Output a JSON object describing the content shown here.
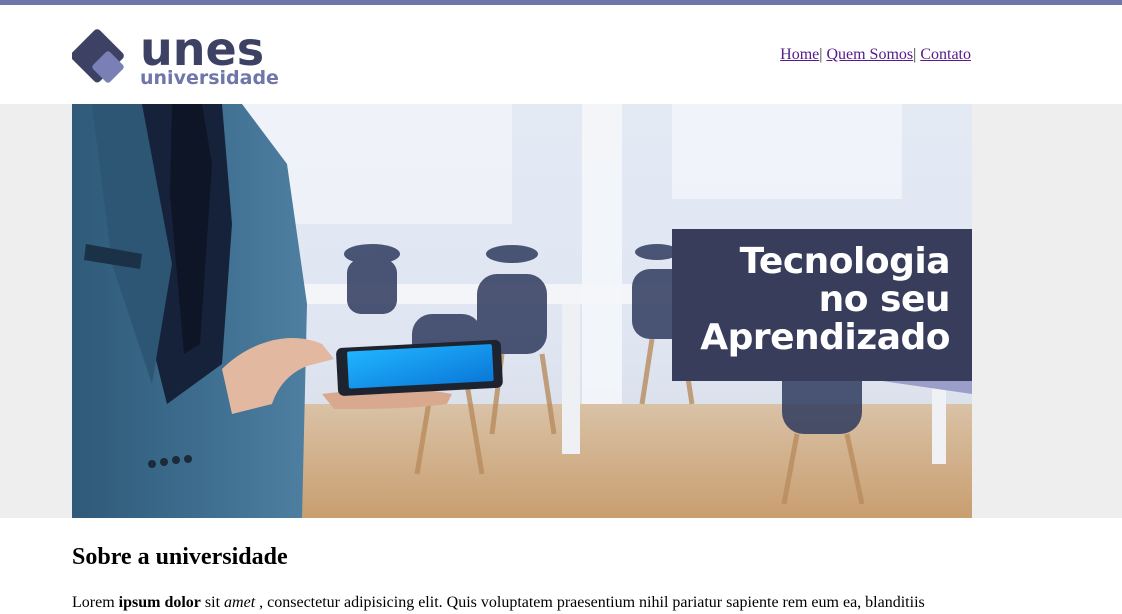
{
  "brand": {
    "name": "unes",
    "tagline": "universidade",
    "colors": {
      "primary": "#3d4164",
      "accent": "#6f76a8"
    }
  },
  "nav": {
    "items": [
      {
        "label": "Home"
      },
      {
        "label": "Quem Somos"
      },
      {
        "label": "Contato"
      }
    ],
    "separator": "|"
  },
  "banner": {
    "caption_lines": [
      "Tecnologia",
      "no seu",
      "Aprendizado"
    ],
    "caption_bg": "#383d5c"
  },
  "about": {
    "title": "Sobre a universidade",
    "paragraph": {
      "t1": "Lorem ",
      "b1": "ipsum dolor",
      "t2": " sit ",
      "i1": "amet",
      "t3": " , consectetur adipisicing elit. Quis voluptatem praesentium nihil pariatur sapiente rem eum ea, blanditiis"
    }
  }
}
